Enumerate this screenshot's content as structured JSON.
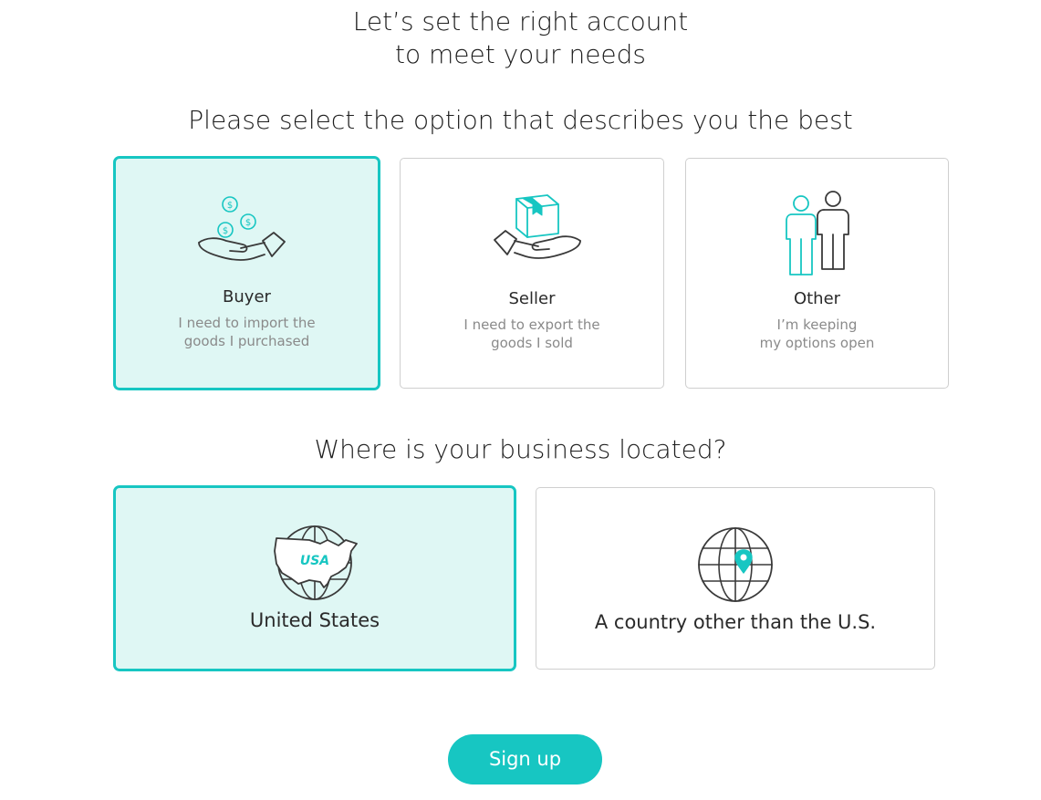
{
  "header": {
    "title_line1": "Let’s set the right account",
    "title_line2": "to meet your needs"
  },
  "role_section": {
    "question": "Please select the option that describes you the best",
    "options": [
      {
        "icon": "hand-coins-icon",
        "label": "Buyer",
        "desc_line1": "I need to import the",
        "desc_line2": "goods I purchased",
        "selected": true
      },
      {
        "icon": "hand-box-icon",
        "label": "Seller",
        "desc_line1": "I need to export the",
        "desc_line2": "goods I sold",
        "selected": false
      },
      {
        "icon": "two-people-icon",
        "label": "Other",
        "desc_line1": "I’m keeping",
        "desc_line2": "my options open",
        "selected": false
      }
    ]
  },
  "location_section": {
    "question": "Where is your business located?",
    "options": [
      {
        "icon": "usa-globe-icon",
        "label": "United States",
        "globe_text": "USA",
        "selected": true
      },
      {
        "icon": "globe-pin-icon",
        "label": "A country other than the U.S.",
        "selected": false
      }
    ]
  },
  "actions": {
    "signup_label": "Sign up"
  },
  "colors": {
    "accent": "#17c6c2",
    "selected_bg": "#dff7f4",
    "border": "#cfcfcf",
    "text": "#1e1e1e",
    "muted": "#8a8a8a",
    "icon_stroke": "#3a3a3a"
  }
}
